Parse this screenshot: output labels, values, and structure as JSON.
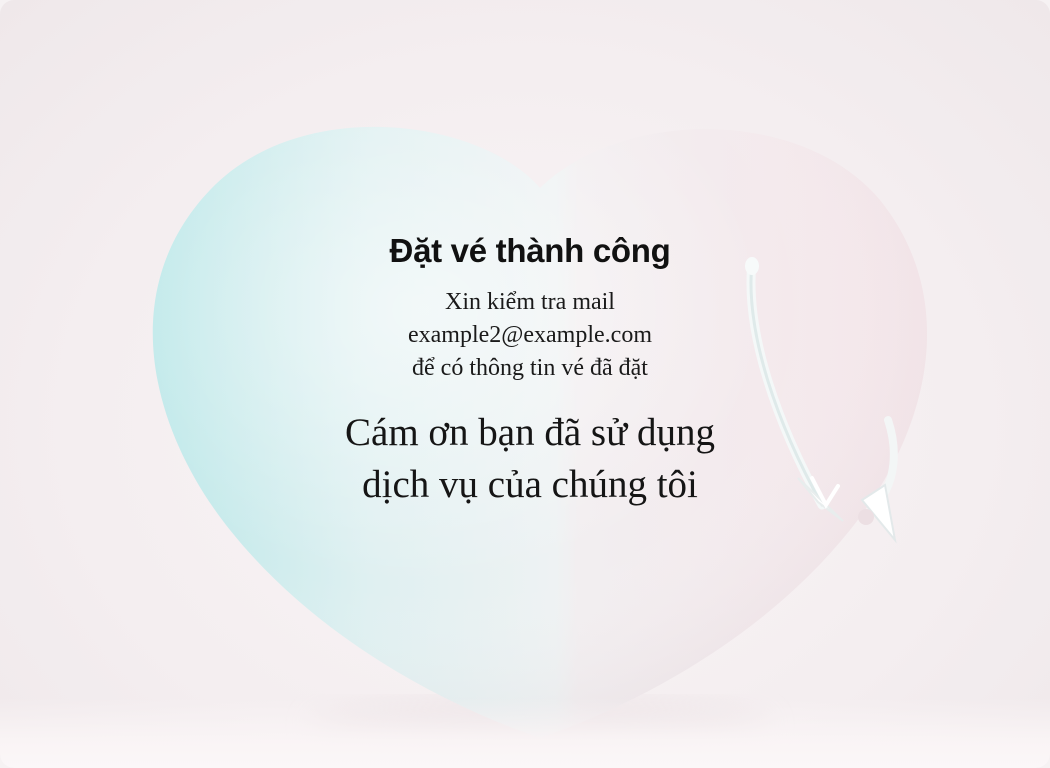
{
  "confirmation": {
    "title": "Đặt vé thành công",
    "check_mail": "Xin kiểm tra mail",
    "email": "example2@example.com",
    "ticket_info": "để có thông tin vé đã đặt",
    "thanks_line_1": "Cám ơn bạn đã sử dụng",
    "thanks_line_2": "dịch vụ của chúng tôi"
  },
  "illustration": {
    "icon": "heart-with-arrow-illustration",
    "colors": {
      "background": "#f4eef0",
      "heart_left": "#bfe9ea",
      "heart_right": "#f3e7eb",
      "arrow": "#ffffff"
    }
  }
}
